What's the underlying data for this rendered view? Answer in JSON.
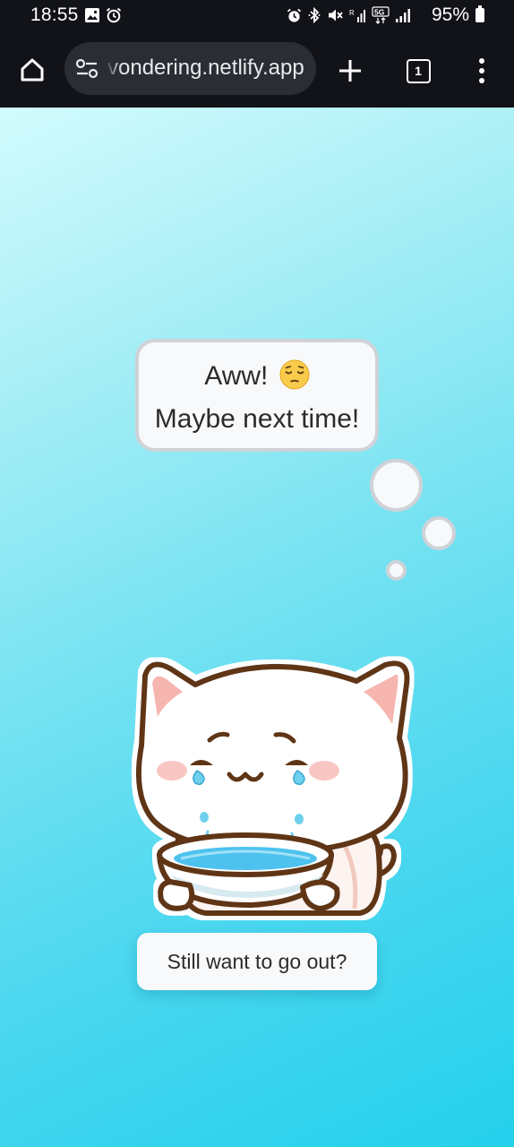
{
  "status_bar": {
    "time": "18:55",
    "battery": "95%",
    "left_icons": [
      "image-icon",
      "alarm-icon"
    ],
    "right_icons": [
      "alarm-icon",
      "bluetooth-icon",
      "mute-icon",
      "wifi-calling-icon",
      "5g-icon",
      "signal-icon"
    ]
  },
  "browser": {
    "url_text": "vondering.netlify.app",
    "tab_count": "1",
    "icons": [
      "home-icon",
      "tune-icon",
      "plus-icon",
      "tab-switcher-icon",
      "more-vert-icon"
    ]
  },
  "page": {
    "bubble": {
      "line1": "Aww!",
      "emoji": "pensive-face-emoji",
      "line2": "Maybe next time!"
    },
    "cta_label": "Still want to go out?"
  },
  "colors": {
    "chrome_bg": "#121318",
    "url_bar_bg": "#2a2d33",
    "page_gradient_start": "#d2fbfd",
    "page_gradient_end": "#24d0ec",
    "bubble_bg": "#f8f9fb",
    "bubble_border": "#cfd2d7"
  }
}
